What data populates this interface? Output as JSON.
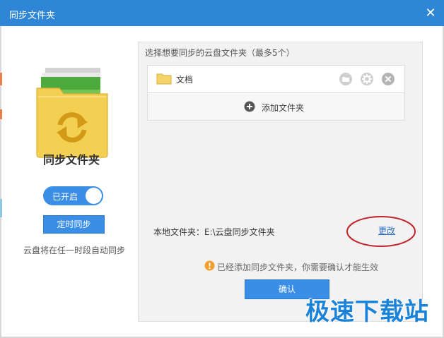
{
  "window": {
    "title": "同步文件夹",
    "close_glyph": "✕"
  },
  "left": {
    "title": "同步文件夹",
    "toggle_label": "已开启",
    "timer_button": "定时同步",
    "description": "云盘将在任一时段自动同步"
  },
  "right": {
    "instruction": "选择想要同步的云盘文件夹（最多5个）",
    "folders": [
      {
        "name": "文档"
      }
    ],
    "add_label": "添加文件夹",
    "local_label": "本地文件夹：E:\\云盘同步文件夹",
    "change_link": "更改",
    "notice": "已经添加同步文件夹，你需要确认才能生效",
    "confirm_button": "确认"
  },
  "watermark": "极速下载站",
  "colors": {
    "titlebar": "#2f86d6",
    "accent": "#3a8ee6",
    "annotation_ring": "#c0262c",
    "watermark": "#1a82d8"
  }
}
